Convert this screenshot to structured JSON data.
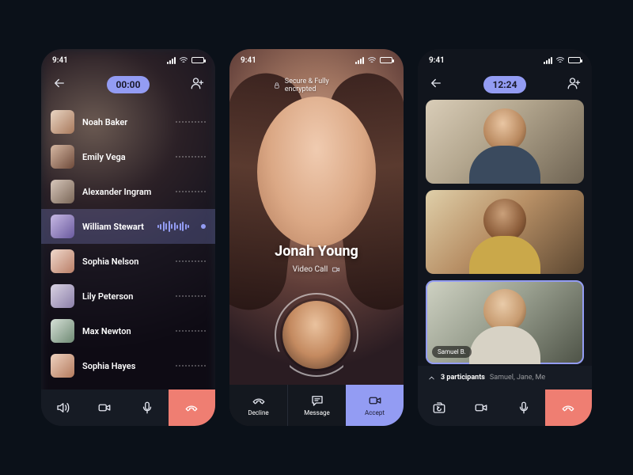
{
  "accent": "#939cf3",
  "danger": "#ef7e72",
  "status_time": "9:41",
  "screen1": {
    "timer": "00:00",
    "contacts": [
      {
        "name": "Noah Baker",
        "avatar_bg": "linear-gradient(135deg,#e9d5c3,#a8795c)",
        "state": "idle"
      },
      {
        "name": "Emily Vega",
        "avatar_bg": "linear-gradient(135deg,#d6b8a3,#6e4a3a)",
        "state": "idle"
      },
      {
        "name": "Alexander Ingram",
        "avatar_bg": "linear-gradient(135deg,#d7c7bb,#7a6657)",
        "state": "idle"
      },
      {
        "name": "William Stewart",
        "avatar_bg": "linear-gradient(135deg,#c7b9e4,#6a5a9e)",
        "state": "talking"
      },
      {
        "name": "Sophia Nelson",
        "avatar_bg": "linear-gradient(135deg,#f0d9cc,#b97e67)",
        "state": "idle"
      },
      {
        "name": "Lily Peterson",
        "avatar_bg": "linear-gradient(135deg,#d9d2e3,#8b7fa8)",
        "state": "idle"
      },
      {
        "name": "Max Newton",
        "avatar_bg": "linear-gradient(135deg,#d6e0d7,#6f8a74)",
        "state": "idle"
      },
      {
        "name": "Sophia Hayes",
        "avatar_bg": "linear-gradient(135deg,#efd2c0,#b37a5d)",
        "state": "idle"
      }
    ]
  },
  "screen2": {
    "secure_label": "Secure & Fully encrypted",
    "caller_name": "Jonah Young",
    "call_type": "Video Call",
    "actions": {
      "decline": "Decline",
      "message": "Message",
      "accept": "Accept"
    }
  },
  "screen3": {
    "timer": "12:24",
    "active_name": "Samuel B.",
    "participants_count": "3 participants",
    "participants_names": "Samuel, Jane, Me"
  }
}
